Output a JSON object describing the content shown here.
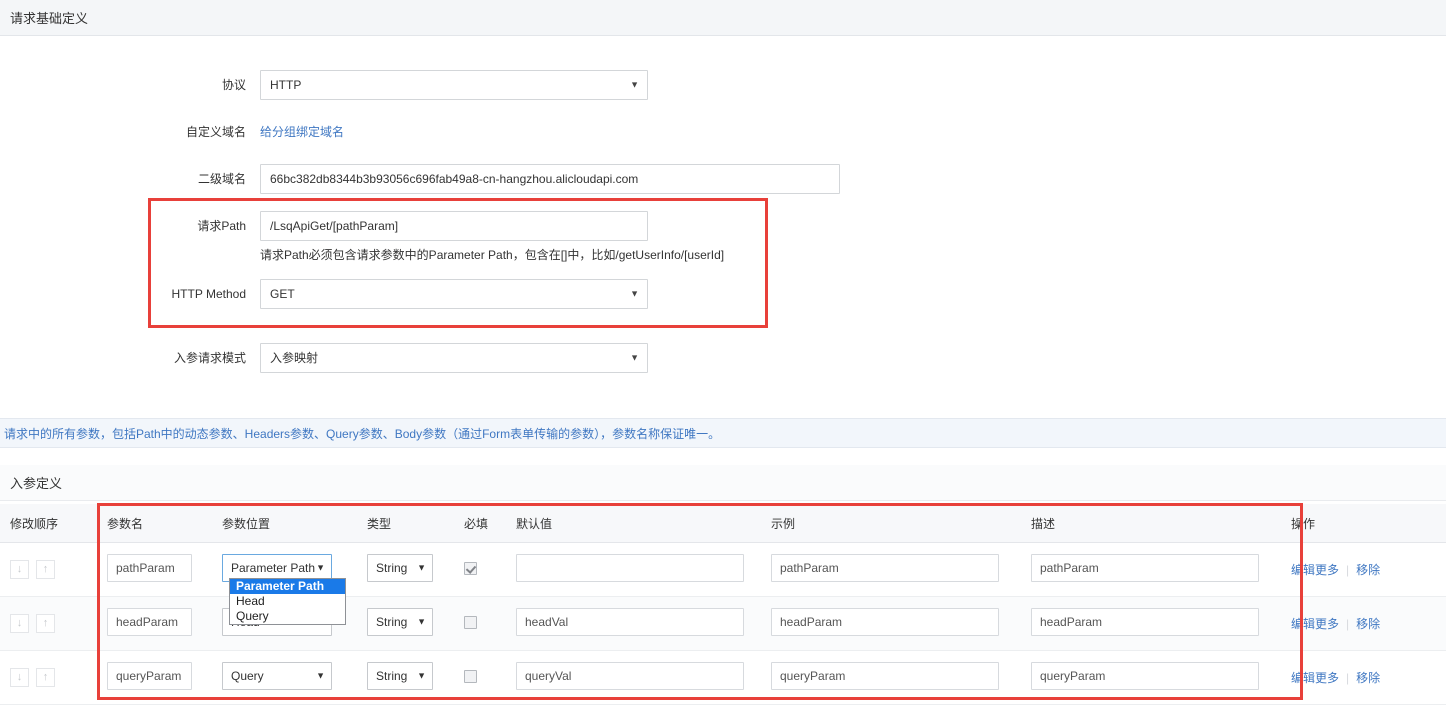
{
  "section": {
    "title": "请求基础定义"
  },
  "form": {
    "protocol": {
      "label": "协议",
      "value": "HTTP",
      "caret": "▼"
    },
    "custom_domain": {
      "label": "自定义域名",
      "link_text": "给分组绑定域名"
    },
    "second_domain": {
      "label": "二级域名",
      "value": "66bc382db8344b3b93056c696fab49a8-cn-hangzhou.alicloudapi.com"
    },
    "request_path": {
      "label": "请求Path",
      "value": "/LsqApiGet/[pathParam]",
      "hint": "请求Path必须包含请求参数中的Parameter Path，包含在[]中，比如/getUserInfo/[userId]"
    },
    "http_method": {
      "label": "HTTP Method",
      "value": "GET",
      "caret": "▼"
    },
    "request_mode": {
      "label": "入参请求模式",
      "value": "入参映射",
      "caret": "▼"
    }
  },
  "info_banner": {
    "text": "请求中的所有参数，包括Path中的动态参数、Headers参数、Query参数、Body参数（通过Form表单传输的参数），参数名称保证唯一。"
  },
  "inparam_section": {
    "title": "入参定义"
  },
  "table": {
    "headers": {
      "order": "修改顺序",
      "name": "参数名",
      "position": "参数位置",
      "type": "类型",
      "required": "必填",
      "default": "默认值",
      "example": "示例",
      "description": "描述",
      "ops": "操作"
    },
    "rows": [
      {
        "name": "pathParam",
        "position": "Parameter Path",
        "type": "String",
        "required": true,
        "default": "",
        "example": "pathParam",
        "description": "pathParam",
        "edit_label": "编辑更多",
        "remove_label": "移除",
        "down_icon": "↓",
        "up_icon": "↑"
      },
      {
        "name": "headParam",
        "position": "Head",
        "type": "String",
        "required": false,
        "default": "headVal",
        "example": "headParam",
        "description": "headParam",
        "edit_label": "编辑更多",
        "remove_label": "移除",
        "down_icon": "↓",
        "up_icon": "↑"
      },
      {
        "name": "queryParam",
        "position": "Query",
        "type": "String",
        "required": false,
        "default": "queryVal",
        "example": "queryParam",
        "description": "queryParam",
        "edit_label": "编辑更多",
        "remove_label": "移除",
        "down_icon": "↓",
        "up_icon": "↑"
      }
    ],
    "caret": "▼"
  },
  "open_dropdown": {
    "options": [
      "Parameter Path",
      "Head",
      "Query"
    ],
    "selected_index": 0
  },
  "colors": {
    "highlight_red": "#e8403a",
    "link_blue": "#3f77c2",
    "dropdown_selected": "#1a7ae8",
    "banner_bg": "#f2f6fb"
  }
}
